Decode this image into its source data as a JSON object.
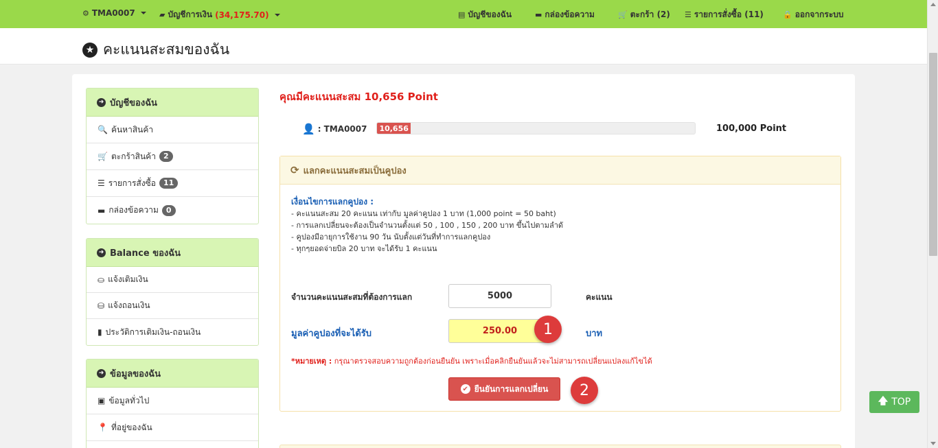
{
  "nav": {
    "user": "TMA0007",
    "account_label": "บัญชีการเงิน",
    "account_balance": "(34,175.70)",
    "my_account": "บัญชีของฉัน",
    "messages": "กล่องข้อความ",
    "cart": "ตะกร้า (2)",
    "orders": "รายการสั่งซื้อ (11)",
    "logout": "ออกจากระบบ"
  },
  "page_title": "คะแนนสะสมของฉัน",
  "sidebar": {
    "account_panel": {
      "title": "บัญชีของฉัน",
      "items": [
        {
          "label": "ค้นหาสินค้า",
          "icon": "search-icon"
        },
        {
          "label": "ตะกร้าสินค้า",
          "badge": "2",
          "icon": "cart-icon"
        },
        {
          "label": "รายการสั่งซื้อ",
          "badge": "11",
          "icon": "list-icon"
        },
        {
          "label": "กล่องข้อความ",
          "badge": "0",
          "icon": "comment-icon"
        }
      ]
    },
    "balance_panel": {
      "title": "Balance ของฉัน",
      "items": [
        {
          "label": "แจ้งเติมเงิน",
          "icon": "deposit-icon"
        },
        {
          "label": "แจ้งถอนเงิน",
          "icon": "withdraw-icon"
        },
        {
          "label": "ประวัติการเติมเงิน-ถอนเงิน",
          "icon": "bar-chart-icon"
        }
      ]
    },
    "info_panel": {
      "title": "ข้อมูลของฉัน",
      "items": [
        {
          "label": "ข้อมูลทั่วไป",
          "icon": "id-card-icon"
        },
        {
          "label": "ที่อยู่ของฉัน",
          "icon": "map-marker-icon"
        }
      ]
    }
  },
  "points": {
    "headline": "คุณมีคะแนนสะสม 10,656 Point",
    "user_label": ": TMA0007",
    "progress_label": "10,656",
    "progress_fraction": 0.10656,
    "goal": "100,000 Point"
  },
  "exchange": {
    "title": "แลกคะแนนสะสมเป็นคูปอง",
    "conditions_title": "เงื่อนไขการแลกคูปอง :",
    "conditions": [
      "- คะแนนสะสม 20 คะแนน เท่ากับ มูลค่าคูปอง 1 บาท  (1,000 point = 50 baht)",
      "- การแลกเปลี่ยนจะต้องเป็นจำนวนตั้งแต่   50 , 100 , 150 , 200 บาท ขึ้นไปตามลำดั",
      "- คูปองมีอายุการใช้งาน 90 วัน นับตั้งแต่วันที่ทำการแลกคูปอง",
      "- ทุกๆยอดจ่ายบิล 20 บาท จะได้รับ 1 คะแนน"
    ],
    "points_label": "จำนวนคะแนนสะสมที่ต้องการแลก",
    "points_value": "5000",
    "points_unit": "คะแนน",
    "coupon_label": "มูลค่าคูปองที่จะได้รับ",
    "coupon_value": "250.00",
    "coupon_unit": "บาท",
    "note_prefix": "*หมายเหตุ :",
    "note_text": " กรุณาตรวจสอบความถูกต้องก่อนยืนยัน เพราะเมื่อคลิกยืนยันแล้วจะไม่สามารถเปลี่ยนแปลงแก้ไขได้",
    "confirm_label": "ยืนยันการแลกเปลี่ยน",
    "step1": "1",
    "step2": "2"
  },
  "top_button": "TOP",
  "colors": {
    "nav_green": "#9ad94a",
    "accent_red": "#e0201b",
    "button_red": "#d9534f",
    "link_blue": "#1a5fb4",
    "top_green": "#5cb85c"
  }
}
